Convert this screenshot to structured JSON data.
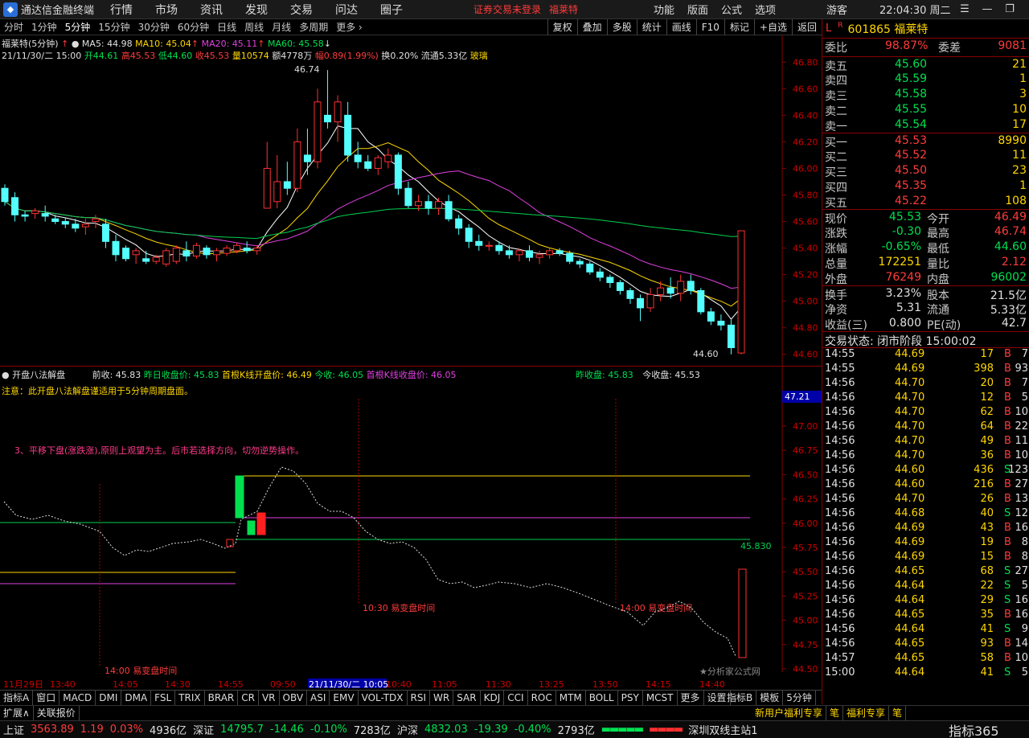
{
  "titlebar": {
    "app_name": "通达信金融终端",
    "menus": [
      "行情",
      "市场",
      "资讯",
      "发现",
      "交易",
      "问达",
      "圈子"
    ],
    "notice": "证券交易未登录",
    "notice_stock": "福莱特",
    "right_menus": [
      "功能",
      "版面",
      "公式",
      "选项"
    ],
    "user": "游客",
    "clock": "22:04:30 周二"
  },
  "periods": [
    "分时",
    "1分钟",
    "5分钟",
    "15分钟",
    "30分钟",
    "60分钟",
    "日线",
    "周线",
    "月线",
    "多周期",
    "更多"
  ],
  "active_period": "5分钟",
  "tools": [
    "复权",
    "叠加",
    "多股",
    "统计",
    "画线",
    "F10",
    "标记",
    "+自选",
    "返回"
  ],
  "main": {
    "legend1": {
      "name": "福莱特(5分钟)",
      "ma5": "MA5: 44.98",
      "ma10": "MA10: 45.04",
      "ma20": "MA20: 45.11",
      "ma60": "MA60: 45.58"
    },
    "legend2": {
      "date": "21/11/30/二 15:00",
      "open": "开44.61",
      "high": "高45.53",
      "low": "低44.60",
      "close": "收45.53",
      "vol": "量10574",
      "amt": "额4778万",
      "amp": "幅0.89(1.99%)",
      "turn": "换0.20%",
      "float": "流通5.33亿",
      "sector": "玻璃"
    },
    "y_ticks": [
      "46.80",
      "46.60",
      "46.40",
      "46.20",
      "46.00",
      "45.80",
      "45.60",
      "45.40",
      "45.20",
      "45.00",
      "44.80",
      "44.60"
    ],
    "high_label": "46.74",
    "low_label": "44.60"
  },
  "sub": {
    "title": "开盘八法解盘",
    "pre_close": "前收: 45.83",
    "prev_close_price": "昨日收盘价: 45.83",
    "first_open": "首根K线开盘价: 46.49",
    "today_close": "今收: 46.05",
    "first_close": "首根K线收盘价: 46.05",
    "y_close": "昨收盘: 45.83",
    "t_close": "今收盘: 45.53",
    "note": "注意：此开盘八法解盘谨适用于5分钟周期盘面。",
    "advice": "3、平移下盘(涨跌涨),原则上观望为主。后市若选择方向，切勿逆势操作。",
    "y_ticks": [
      "47.00",
      "46.75",
      "46.50",
      "46.25",
      "46.00",
      "45.75",
      "45.50",
      "45.25",
      "45.00",
      "44.75",
      "44.50"
    ],
    "cur_label": "47.21",
    "line_label": "45.830",
    "m1": "14:00 易变盘时间",
    "m2": "10:30 易变盘时间",
    "m3": "14:00 易变盘时间",
    "x_ticks": [
      "11月29日",
      "13:40",
      "14:05",
      "14:30",
      "14:55",
      "09:50",
      "21/11/30/二 10:05",
      "10:40",
      "11:05",
      "11:30",
      "13:25",
      "13:50",
      "14:15",
      "14:40"
    ],
    "watermark": "★分析家公式网"
  },
  "tabs": [
    "指标A",
    "窗口",
    "MACD",
    "DMI",
    "DMA",
    "FSL",
    "TRIX",
    "BRAR",
    "CR",
    "VR",
    "OBV",
    "ASI",
    "EMV",
    "VOL-TDX",
    "RSI",
    "WR",
    "SAR",
    "KDJ",
    "CCI",
    "ROC",
    "MTM",
    "BOLL",
    "PSY",
    "MCST",
    "更多",
    "设置"
  ],
  "tabs_right": [
    "指标B",
    "模板",
    "5分钟"
  ],
  "tabs2": [
    "扩展∧",
    "关联报价"
  ],
  "tabs2_right": [
    "新用户福利专享",
    "笔",
    "福利专享",
    "笔"
  ],
  "stock": {
    "code": "601865",
    "name": "福莱特"
  },
  "quote": {
    "weibi": "98.87%",
    "weicha": "9081",
    "asks": [
      [
        "卖五",
        "45.60",
        "21"
      ],
      [
        "卖四",
        "45.59",
        "1"
      ],
      [
        "卖三",
        "45.58",
        "3"
      ],
      [
        "卖二",
        "45.55",
        "10"
      ],
      [
        "卖一",
        "45.54",
        "17"
      ]
    ],
    "bids": [
      [
        "买一",
        "45.53",
        "8990"
      ],
      [
        "买二",
        "45.52",
        "11"
      ],
      [
        "买三",
        "45.50",
        "23"
      ],
      [
        "买四",
        "45.35",
        "1"
      ],
      [
        "买五",
        "45.22",
        "108"
      ]
    ],
    "price": "45.53",
    "open": "46.49",
    "chg": "-0.30",
    "high": "46.74",
    "pct": "-0.65%",
    "low": "44.60",
    "vol": "172251",
    "vr": "2.12",
    "outer": "76249",
    "inner": "96002",
    "turnover": "3.23%",
    "shares": "21.5亿",
    "nav": "5.31",
    "float": "5.33亿",
    "eps": "0.800",
    "pe": "42.7",
    "state": "交易状态: 闭市阶段 15:00:02"
  },
  "ticks": [
    [
      "14:55",
      "44.69",
      "17",
      "B",
      "7"
    ],
    [
      "14:55",
      "44.69",
      "398",
      "B",
      "93"
    ],
    [
      "14:56",
      "44.70",
      "20",
      "B",
      "7"
    ],
    [
      "14:56",
      "44.70",
      "12",
      "B",
      "5"
    ],
    [
      "14:56",
      "44.70",
      "62",
      "B",
      "10"
    ],
    [
      "14:56",
      "44.70",
      "64",
      "B",
      "22"
    ],
    [
      "14:56",
      "44.70",
      "49",
      "B",
      "11"
    ],
    [
      "14:56",
      "44.70",
      "36",
      "B",
      "10"
    ],
    [
      "14:56",
      "44.60",
      "436",
      "S",
      "123"
    ],
    [
      "14:56",
      "44.60",
      "216",
      "B",
      "27"
    ],
    [
      "14:56",
      "44.70",
      "26",
      "B",
      "13"
    ],
    [
      "14:56",
      "44.68",
      "40",
      "S",
      "12"
    ],
    [
      "14:56",
      "44.69",
      "43",
      "B",
      "16"
    ],
    [
      "14:56",
      "44.69",
      "19",
      "B",
      "8"
    ],
    [
      "14:56",
      "44.69",
      "15",
      "B",
      "8"
    ],
    [
      "14:56",
      "44.65",
      "68",
      "S",
      "27"
    ],
    [
      "14:56",
      "44.64",
      "22",
      "S",
      "5"
    ],
    [
      "14:56",
      "44.64",
      "29",
      "S",
      "16"
    ],
    [
      "14:56",
      "44.65",
      "35",
      "B",
      "16"
    ],
    [
      "14:56",
      "44.64",
      "41",
      "S",
      "9"
    ],
    [
      "14:56",
      "44.65",
      "93",
      "B",
      "14"
    ],
    [
      "14:57",
      "44.65",
      "58",
      "B",
      "10"
    ],
    [
      "15:00",
      "44.64",
      "41",
      "S",
      "5"
    ]
  ],
  "statusbar": {
    "sh": "上证",
    "sh_val": "3563.89",
    "sh_chg": "1.19",
    "sh_pct": "0.03%",
    "sh_amt": "4936亿",
    "sz": "深证",
    "sz_val": "14795.7",
    "sz_chg": "-14.46",
    "sz_pct": "-0.10%",
    "sz_amt": "7283亿",
    "hs": "沪深",
    "hs_val": "4832.03",
    "hs_chg": "-19.39",
    "hs_pct": "-0.40%",
    "hs_amt": "2793亿",
    "site": "深圳双线主站1",
    "brand": "指标365"
  },
  "chart_data": {
    "type": "candlestick",
    "ylim": [
      44.55,
      46.85
    ],
    "candles": [
      [
        45.85,
        45.88,
        45.72,
        45.75
      ],
      [
        45.78,
        45.82,
        45.6,
        45.65
      ],
      [
        45.65,
        45.68,
        45.6,
        45.64
      ],
      [
        45.66,
        45.7,
        45.62,
        45.68
      ],
      [
        45.66,
        45.72,
        45.6,
        45.64
      ],
      [
        45.62,
        45.65,
        45.58,
        45.6
      ],
      [
        45.6,
        45.63,
        45.55,
        45.58
      ],
      [
        45.58,
        45.62,
        45.52,
        45.55
      ],
      [
        45.56,
        45.62,
        45.5,
        45.58
      ],
      [
        45.6,
        45.65,
        45.55,
        45.62
      ],
      [
        45.58,
        45.62,
        45.4,
        45.45
      ],
      [
        45.45,
        45.5,
        45.3,
        45.35
      ],
      [
        45.4,
        45.42,
        45.3,
        45.32
      ],
      [
        45.35,
        45.4,
        45.28,
        45.38
      ],
      [
        45.32,
        45.38,
        45.28,
        45.3
      ],
      [
        45.3,
        45.35,
        45.28,
        45.33
      ],
      [
        45.28,
        45.4,
        45.26,
        45.38
      ],
      [
        45.3,
        45.42,
        45.28,
        45.4
      ],
      [
        45.38,
        45.45,
        45.3,
        45.34
      ],
      [
        45.34,
        45.44,
        45.32,
        45.42
      ],
      [
        45.4,
        45.42,
        45.32,
        45.35
      ],
      [
        45.35,
        45.4,
        45.3,
        45.38
      ],
      [
        45.36,
        45.42,
        45.34,
        45.4
      ],
      [
        45.38,
        45.44,
        45.36,
        45.42
      ],
      [
        45.4,
        45.45,
        45.36,
        45.38
      ],
      [
        45.38,
        45.42,
        45.35,
        45.4
      ],
      [
        45.7,
        46.2,
        45.75,
        46.0
      ],
      [
        45.75,
        46.1,
        45.7,
        45.9
      ],
      [
        45.9,
        46.05,
        45.8,
        45.85
      ],
      [
        45.85,
        46.3,
        45.82,
        46.2
      ],
      [
        46.1,
        46.3,
        45.95,
        46.05
      ],
      [
        46.05,
        46.6,
        46.0,
        46.5
      ],
      [
        46.4,
        46.74,
        46.3,
        46.35
      ],
      [
        46.35,
        46.55,
        46.2,
        46.5
      ],
      [
        46.4,
        46.5,
        46.05,
        46.1
      ],
      [
        46.1,
        46.2,
        46.0,
        46.05
      ],
      [
        46.05,
        46.1,
        45.98,
        46.0
      ],
      [
        46.0,
        46.1,
        45.95,
        46.08
      ],
      [
        46.05,
        46.15,
        46.0,
        46.1
      ],
      [
        46.1,
        46.12,
        45.8,
        45.85
      ],
      [
        45.85,
        45.9,
        45.7,
        45.72
      ],
      [
        45.72,
        45.8,
        45.68,
        45.75
      ],
      [
        45.75,
        45.8,
        45.65,
        45.7
      ],
      [
        45.7,
        45.78,
        45.65,
        45.75
      ],
      [
        45.75,
        45.8,
        45.6,
        45.62
      ],
      [
        45.62,
        45.65,
        45.5,
        45.55
      ],
      [
        45.55,
        45.58,
        45.4,
        45.45
      ],
      [
        45.45,
        45.5,
        45.38,
        45.42
      ],
      [
        45.42,
        45.45,
        45.38,
        45.42
      ],
      [
        45.42,
        45.45,
        45.35,
        45.38
      ],
      [
        45.38,
        45.42,
        45.32,
        45.35
      ],
      [
        45.35,
        45.4,
        45.3,
        45.38
      ],
      [
        45.38,
        45.42,
        45.3,
        45.33
      ],
      [
        45.33,
        45.38,
        45.28,
        45.35
      ],
      [
        45.35,
        45.4,
        45.32,
        45.38
      ],
      [
        45.38,
        45.4,
        45.34,
        45.36
      ],
      [
        45.36,
        45.38,
        45.28,
        45.3
      ],
      [
        45.3,
        45.32,
        45.25,
        45.28
      ],
      [
        45.28,
        45.3,
        45.2,
        45.22
      ],
      [
        45.22,
        45.25,
        45.15,
        45.18
      ],
      [
        45.18,
        45.2,
        45.1,
        45.14
      ],
      [
        45.14,
        45.16,
        45.05,
        45.08
      ],
      [
        45.08,
        45.1,
        44.98,
        45.02
      ],
      [
        45.02,
        45.05,
        44.85,
        44.95
      ],
      [
        44.95,
        45.1,
        44.92,
        45.05
      ],
      [
        45.05,
        45.15,
        45.0,
        45.1
      ],
      [
        45.1,
        45.18,
        45.02,
        45.06
      ],
      [
        45.06,
        45.2,
        45.0,
        45.15
      ],
      [
        45.15,
        45.2,
        45.05,
        45.08
      ],
      [
        45.08,
        45.1,
        44.9,
        44.92
      ],
      [
        44.92,
        44.95,
        44.82,
        44.85
      ],
      [
        44.85,
        44.9,
        44.78,
        44.82
      ],
      [
        44.82,
        44.86,
        44.6,
        44.65
      ],
      [
        44.61,
        45.53,
        44.6,
        45.53
      ]
    ]
  }
}
